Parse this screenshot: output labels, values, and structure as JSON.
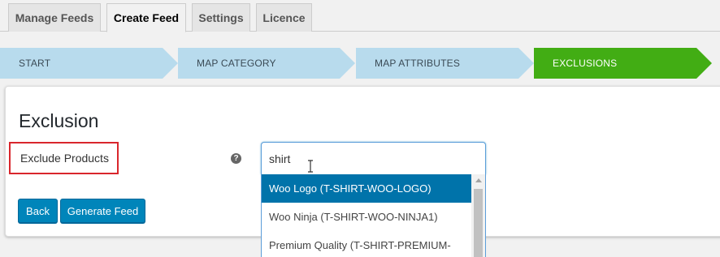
{
  "tabs": [
    {
      "label": "Manage Feeds"
    },
    {
      "label": "Create Feed"
    },
    {
      "label": "Settings"
    },
    {
      "label": "Licence"
    }
  ],
  "steps": [
    {
      "label": "START"
    },
    {
      "label": "MAP CATEGORY"
    },
    {
      "label": "MAP ATTRIBUTES"
    },
    {
      "label": "EXCLUSIONS"
    }
  ],
  "panel": {
    "title": "Exclusion",
    "exclude_label": "Exclude Products",
    "help_icon": "question-mark-icon",
    "help_glyph": "?",
    "back_label": "Back",
    "generate_label": "Generate Feed"
  },
  "search": {
    "value": "shirt",
    "options": [
      {
        "label": "Woo Logo (T-SHIRT-WOO-LOGO)"
      },
      {
        "label": "Woo Ninja (T-SHIRT-WOO-NINJA1)"
      },
      {
        "label": "Premium Quality (T-SHIRT-PREMIUM-"
      }
    ]
  },
  "colors": {
    "accent_blue": "#0085ba",
    "step_inactive": "#b8dbed",
    "step_active": "#42ad14",
    "highlight_red": "#d9262c",
    "option_highlight": "#0073aa"
  }
}
